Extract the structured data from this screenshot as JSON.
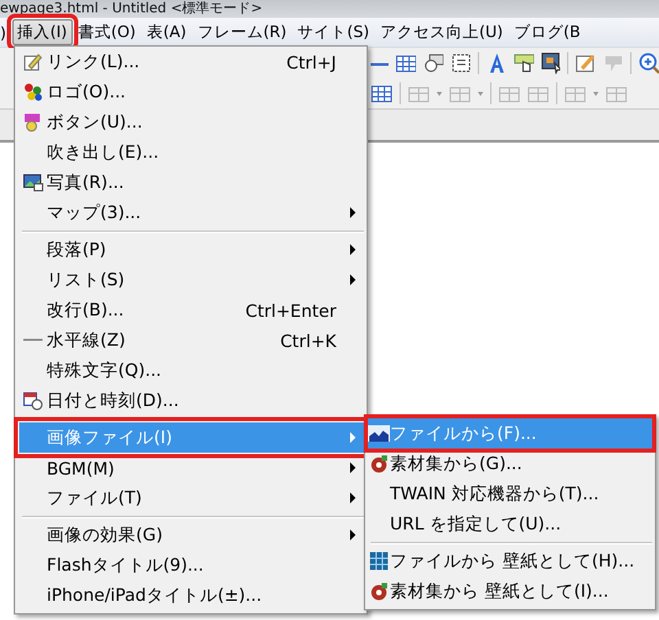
{
  "window": {
    "title": "ewpage3.html - Untitled <標準モード>"
  },
  "menubar": [
    {
      "label": ")",
      "selected": false,
      "highlighted": false
    },
    {
      "label": "挿入(I)",
      "selected": true,
      "highlighted": true
    },
    {
      "label": "書式(O)",
      "selected": false,
      "highlighted": false
    },
    {
      "label": "表(A)",
      "selected": false,
      "highlighted": false
    },
    {
      "label": "フレーム(R)",
      "selected": false,
      "highlighted": false
    },
    {
      "label": "サイト(S)",
      "selected": false,
      "highlighted": false
    },
    {
      "label": "アクセス向上(U)",
      "selected": false,
      "highlighted": false
    },
    {
      "label": "ブログ(B",
      "selected": false,
      "highlighted": false
    }
  ],
  "insert_menu": [
    {
      "kind": "item",
      "label": "リンク(L)...",
      "shortcut": "Ctrl+J",
      "submenu": false,
      "selected": false,
      "highlighted": false
    },
    {
      "kind": "item",
      "label": "ロゴ(O)...",
      "submenu": false,
      "selected": false,
      "highlighted": false
    },
    {
      "kind": "item",
      "label": "ボタン(U)...",
      "submenu": false,
      "selected": false,
      "highlighted": false
    },
    {
      "kind": "item",
      "label": "吹き出し(E)...",
      "submenu": false,
      "selected": false,
      "highlighted": false
    },
    {
      "kind": "item",
      "label": "写真(R)...",
      "submenu": false,
      "selected": false,
      "highlighted": false
    },
    {
      "kind": "item",
      "label": "マップ(3)...",
      "submenu": true,
      "selected": false,
      "highlighted": false
    },
    {
      "kind": "separator"
    },
    {
      "kind": "item",
      "label": "段落(P)",
      "submenu": true,
      "selected": false,
      "highlighted": false
    },
    {
      "kind": "item",
      "label": "リスト(S)",
      "submenu": true,
      "selected": false,
      "highlighted": false
    },
    {
      "kind": "item",
      "label": "改行(B)...",
      "shortcut": "Ctrl+Enter",
      "submenu": false,
      "selected": false,
      "highlighted": false
    },
    {
      "kind": "item",
      "label": "水平線(Z)",
      "shortcut": "Ctrl+K",
      "submenu": false,
      "selected": false,
      "highlighted": false
    },
    {
      "kind": "item",
      "label": "特殊文字(Q)...",
      "submenu": false,
      "selected": false,
      "highlighted": false
    },
    {
      "kind": "item",
      "label": "日付と時刻(D)...",
      "submenu": false,
      "selected": false,
      "highlighted": false
    },
    {
      "kind": "separator"
    },
    {
      "kind": "item",
      "label": "画像ファイル(I)",
      "submenu": true,
      "selected": true,
      "highlighted": true
    },
    {
      "kind": "item",
      "label": "BGM(M)",
      "submenu": true,
      "selected": false,
      "highlighted": false
    },
    {
      "kind": "item",
      "label": "ファイル(T)",
      "submenu": true,
      "selected": false,
      "highlighted": false
    },
    {
      "kind": "separator"
    },
    {
      "kind": "item",
      "label": "画像の効果(G)",
      "submenu": true,
      "selected": false,
      "highlighted": false
    },
    {
      "kind": "item",
      "label": "Flashタイトル(9)...",
      "submenu": false,
      "selected": false,
      "highlighted": false
    },
    {
      "kind": "item",
      "label": "iPhone/iPadタイトル(±)...",
      "submenu": false,
      "selected": false,
      "highlighted": false
    }
  ],
  "image_file_submenu": [
    {
      "kind": "item",
      "label": "ファイルから(F)...",
      "submenu": false,
      "selected": true,
      "highlighted": true
    },
    {
      "kind": "item",
      "label": "素材集から(G)...",
      "submenu": false,
      "selected": false,
      "highlighted": false
    },
    {
      "kind": "item",
      "label": "TWAIN 対応機器から(T)...",
      "submenu": false,
      "selected": false,
      "highlighted": false
    },
    {
      "kind": "item",
      "label": "URL を指定して(U)...",
      "submenu": false,
      "selected": false,
      "highlighted": false
    },
    {
      "kind": "separator"
    },
    {
      "kind": "item",
      "label": "ファイルから 壁紙として(H)...",
      "submenu": false,
      "selected": false,
      "highlighted": false
    },
    {
      "kind": "item",
      "label": "素材集から 壁紙として(I)...",
      "submenu": false,
      "selected": false,
      "highlighted": false
    }
  ]
}
